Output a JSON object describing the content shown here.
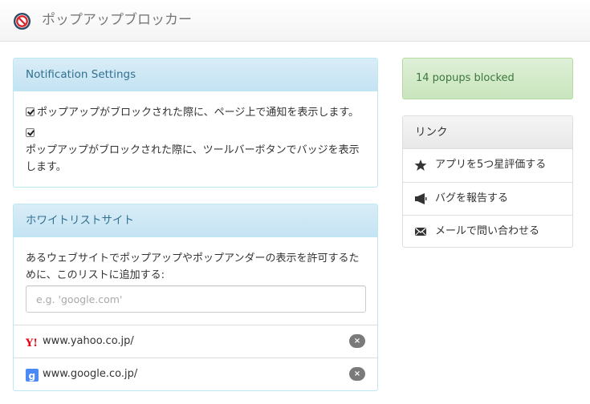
{
  "app": {
    "title": "ポップアップブロッカー",
    "icon": "no-entry-icon"
  },
  "notification": {
    "heading": "Notification Settings",
    "options": [
      {
        "label": "ポップアップがブロックされた際に、ページ上で通知を表示します。",
        "checked": true
      },
      {
        "label": "ポップアップがブロックされた際に、ツールバーボタンでバッジを表示します。",
        "checked": true
      }
    ]
  },
  "whitelist": {
    "heading": "ホワイトリストサイト",
    "description": "あるウェブサイトでポップアップやポップアンダーの表示を許可するために、このリストに追加する:",
    "placeholder": "e.g. 'google.com'",
    "sites": [
      {
        "url": "www.yahoo.co.jp/",
        "icon": "yahoo-icon"
      },
      {
        "url": "www.google.co.jp/",
        "icon": "google-icon"
      }
    ],
    "remove_glyph": "×"
  },
  "stats": {
    "text": "14 popups blocked"
  },
  "links": {
    "heading": "リンク",
    "items": [
      {
        "label": "アプリを5つ星評価する",
        "icon": "star-icon"
      },
      {
        "label": "バグを報告する",
        "icon": "megaphone-icon"
      },
      {
        "label": "メールで問い合わせる",
        "icon": "envelope-icon"
      }
    ]
  },
  "colors": {
    "info_heading": "#d9edf7",
    "info_text": "#31708f",
    "success_bg": "#dff0d8",
    "success_text": "#3c763d"
  }
}
